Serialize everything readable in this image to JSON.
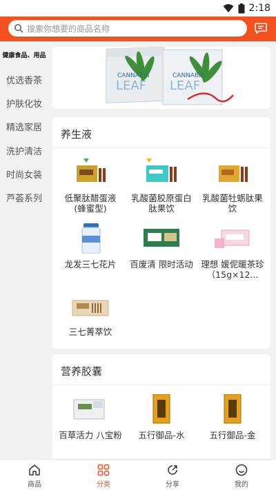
{
  "status_bar": {
    "time": "2:18"
  },
  "search": {
    "placeholder": "搜索你想要的商品名称"
  },
  "sidebar": {
    "items": [
      {
        "label": "健康食品、用品"
      },
      {
        "label": "优选香茶"
      },
      {
        "label": "护肤化妆"
      },
      {
        "label": "精选家居"
      },
      {
        "label": "洗护清洁"
      },
      {
        "label": "时尚女装"
      },
      {
        "label": "芦荟系列"
      }
    ]
  },
  "banner": {
    "brand_text": "CANNABIS LEAF"
  },
  "sections": [
    {
      "title": "养生液",
      "products": [
        {
          "name": "低聚肽醋蛋液(蜂蜜型)"
        },
        {
          "name": "乳酸菌胶原蛋白肽果饮"
        },
        {
          "name": "乳酸菌牡蛎肽果饮"
        },
        {
          "name": "龙发三七花片"
        },
        {
          "name": "百废清 限时活动"
        },
        {
          "name": "理想 媛伲暖茶珍（15g×12..."
        },
        {
          "name": "三七菁萃饮"
        }
      ]
    },
    {
      "title": "营养胶囊",
      "products": [
        {
          "name": "百草活力 八宝粉"
        },
        {
          "name": "五行御品-水"
        },
        {
          "name": "五行御品-金"
        }
      ]
    }
  ],
  "bottom_nav": {
    "items": [
      {
        "label": "商品",
        "icon": "home-icon"
      },
      {
        "label": "分类",
        "icon": "grid-icon"
      },
      {
        "label": "分享",
        "icon": "share-icon"
      },
      {
        "label": "我的",
        "icon": "smile-icon"
      }
    ]
  },
  "colors": {
    "accent": "#f4511e",
    "background": "#f2f2f2"
  }
}
